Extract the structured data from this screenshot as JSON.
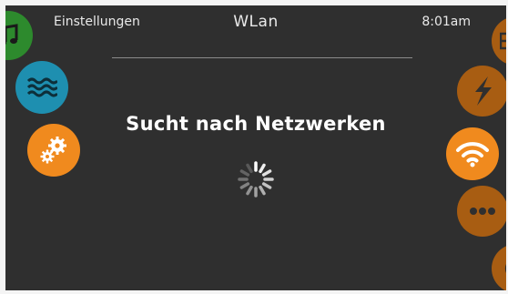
{
  "header": {
    "left": "Einstellungen",
    "center": "WLan",
    "right": "8:01am"
  },
  "main": {
    "status": "Sucht nach Netzwerken"
  },
  "colors": {
    "background": "#2f2f2f",
    "orange": "#f08a1e",
    "orange_dim": "#a85d12",
    "teal": "#1e8fb0",
    "green": "#2d8a2d"
  },
  "icons": {
    "left": [
      "music-icon",
      "water-icon",
      "settings-icon"
    ],
    "right": [
      "calendar-icon",
      "power-icon",
      "wifi-icon",
      "more-icon",
      "bottom-icon"
    ]
  }
}
